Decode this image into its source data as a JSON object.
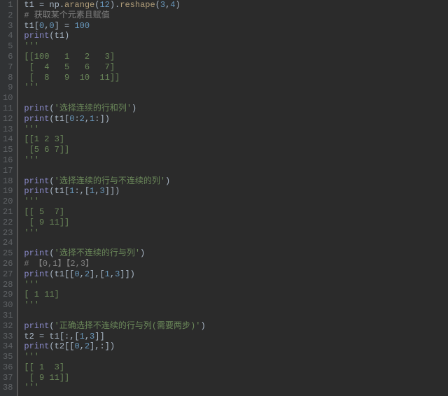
{
  "lines": [
    {
      "n": 1,
      "tokens": [
        {
          "t": "t1 ",
          "c": "tok-id"
        },
        {
          "t": "= ",
          "c": "tok-op"
        },
        {
          "t": "np",
          "c": "tok-id"
        },
        {
          "t": ".",
          "c": "tok-op"
        },
        {
          "t": "arange",
          "c": "tok-call"
        },
        {
          "t": "(",
          "c": "tok-op"
        },
        {
          "t": "12",
          "c": "tok-num"
        },
        {
          "t": ").",
          "c": "tok-op"
        },
        {
          "t": "reshape",
          "c": "tok-call"
        },
        {
          "t": "(",
          "c": "tok-op"
        },
        {
          "t": "3",
          "c": "tok-num"
        },
        {
          "t": ",",
          "c": "tok-op"
        },
        {
          "t": "4",
          "c": "tok-num"
        },
        {
          "t": ")",
          "c": "tok-op"
        }
      ]
    },
    {
      "n": 2,
      "tokens": [
        {
          "t": "# 获取某个元素且赋值",
          "c": "tok-comment"
        }
      ]
    },
    {
      "n": 3,
      "tokens": [
        {
          "t": "t1",
          "c": "tok-id"
        },
        {
          "t": "[",
          "c": "tok-op"
        },
        {
          "t": "0",
          "c": "tok-num"
        },
        {
          "t": ",",
          "c": "tok-op"
        },
        {
          "t": "0",
          "c": "tok-num"
        },
        {
          "t": "] ",
          "c": "tok-op"
        },
        {
          "t": "= ",
          "c": "tok-op"
        },
        {
          "t": "100",
          "c": "tok-num"
        }
      ]
    },
    {
      "n": 4,
      "tokens": [
        {
          "t": "print",
          "c": "tok-builtin"
        },
        {
          "t": "(",
          "c": "tok-op"
        },
        {
          "t": "t1",
          "c": "tok-id"
        },
        {
          "t": ")",
          "c": "tok-op"
        }
      ]
    },
    {
      "n": 5,
      "tokens": [
        {
          "t": "'''",
          "c": "tok-str"
        }
      ]
    },
    {
      "n": 6,
      "tokens": [
        {
          "t": "[[100   1   2   3]",
          "c": "tok-str"
        }
      ]
    },
    {
      "n": 7,
      "tokens": [
        {
          "t": " [  4   5   6   7]",
          "c": "tok-str"
        }
      ]
    },
    {
      "n": 8,
      "tokens": [
        {
          "t": " [  8   9  10  11]]",
          "c": "tok-str"
        }
      ]
    },
    {
      "n": 9,
      "tokens": [
        {
          "t": "'''",
          "c": "tok-str"
        }
      ]
    },
    {
      "n": 10,
      "tokens": []
    },
    {
      "n": 11,
      "tokens": [
        {
          "t": "print",
          "c": "tok-builtin"
        },
        {
          "t": "(",
          "c": "tok-op"
        },
        {
          "t": "'选择连续的行和列'",
          "c": "tok-str"
        },
        {
          "t": ")",
          "c": "tok-op"
        }
      ]
    },
    {
      "n": 12,
      "tokens": [
        {
          "t": "print",
          "c": "tok-builtin"
        },
        {
          "t": "(",
          "c": "tok-op"
        },
        {
          "t": "t1",
          "c": "tok-id"
        },
        {
          "t": "[",
          "c": "tok-op"
        },
        {
          "t": "0",
          "c": "tok-num"
        },
        {
          "t": ":",
          "c": "tok-op"
        },
        {
          "t": "2",
          "c": "tok-num"
        },
        {
          "t": ",",
          "c": "tok-op"
        },
        {
          "t": "1",
          "c": "tok-num"
        },
        {
          "t": ":])",
          "c": "tok-op"
        }
      ]
    },
    {
      "n": 13,
      "tokens": [
        {
          "t": "'''",
          "c": "tok-str"
        }
      ]
    },
    {
      "n": 14,
      "tokens": [
        {
          "t": "[[1 2 3]",
          "c": "tok-str"
        }
      ]
    },
    {
      "n": 15,
      "tokens": [
        {
          "t": " [5 6 7]]",
          "c": "tok-str"
        }
      ]
    },
    {
      "n": 16,
      "tokens": [
        {
          "t": "'''",
          "c": "tok-str"
        }
      ]
    },
    {
      "n": 17,
      "tokens": []
    },
    {
      "n": 18,
      "tokens": [
        {
          "t": "print",
          "c": "tok-builtin"
        },
        {
          "t": "(",
          "c": "tok-op"
        },
        {
          "t": "'选择连续的行与不连续的列'",
          "c": "tok-str"
        },
        {
          "t": ")",
          "c": "tok-op"
        }
      ]
    },
    {
      "n": 19,
      "tokens": [
        {
          "t": "print",
          "c": "tok-builtin"
        },
        {
          "t": "(",
          "c": "tok-op"
        },
        {
          "t": "t1",
          "c": "tok-id"
        },
        {
          "t": "[",
          "c": "tok-op"
        },
        {
          "t": "1",
          "c": "tok-num"
        },
        {
          "t": ":,[",
          "c": "tok-op"
        },
        {
          "t": "1",
          "c": "tok-num"
        },
        {
          "t": ",",
          "c": "tok-op"
        },
        {
          "t": "3",
          "c": "tok-num"
        },
        {
          "t": "]])",
          "c": "tok-op"
        }
      ]
    },
    {
      "n": 20,
      "tokens": [
        {
          "t": "'''",
          "c": "tok-str"
        }
      ]
    },
    {
      "n": 21,
      "tokens": [
        {
          "t": "[[ 5  7]",
          "c": "tok-str"
        }
      ]
    },
    {
      "n": 22,
      "tokens": [
        {
          "t": " [ 9 11]]",
          "c": "tok-str"
        }
      ]
    },
    {
      "n": 23,
      "tokens": [
        {
          "t": "'''",
          "c": "tok-str"
        }
      ]
    },
    {
      "n": 24,
      "tokens": []
    },
    {
      "n": 25,
      "tokens": [
        {
          "t": "print",
          "c": "tok-builtin"
        },
        {
          "t": "(",
          "c": "tok-op"
        },
        {
          "t": "'选择不连续的行与列'",
          "c": "tok-str"
        },
        {
          "t": ")",
          "c": "tok-op"
        }
      ]
    },
    {
      "n": 26,
      "tokens": [
        {
          "t": "# 【0,1】【2,3】",
          "c": "tok-comment"
        }
      ]
    },
    {
      "n": 27,
      "tokens": [
        {
          "t": "print",
          "c": "tok-builtin"
        },
        {
          "t": "(",
          "c": "tok-op"
        },
        {
          "t": "t1",
          "c": "tok-id"
        },
        {
          "t": "[[",
          "c": "tok-op"
        },
        {
          "t": "0",
          "c": "tok-num"
        },
        {
          "t": ",",
          "c": "tok-op"
        },
        {
          "t": "2",
          "c": "tok-num"
        },
        {
          "t": "],[",
          "c": "tok-op"
        },
        {
          "t": "1",
          "c": "tok-num"
        },
        {
          "t": ",",
          "c": "tok-op"
        },
        {
          "t": "3",
          "c": "tok-num"
        },
        {
          "t": "]])",
          "c": "tok-op"
        }
      ]
    },
    {
      "n": 28,
      "tokens": [
        {
          "t": "'''",
          "c": "tok-str"
        }
      ]
    },
    {
      "n": 29,
      "tokens": [
        {
          "t": "[ 1 11]",
          "c": "tok-str"
        }
      ]
    },
    {
      "n": 30,
      "tokens": [
        {
          "t": "'''",
          "c": "tok-str"
        }
      ]
    },
    {
      "n": 31,
      "tokens": []
    },
    {
      "n": 32,
      "tokens": [
        {
          "t": "print",
          "c": "tok-builtin"
        },
        {
          "t": "(",
          "c": "tok-op"
        },
        {
          "t": "'正确选择不连续的行与列(需要两步)'",
          "c": "tok-str"
        },
        {
          "t": ")",
          "c": "tok-op"
        }
      ]
    },
    {
      "n": 33,
      "tokens": [
        {
          "t": "t2 ",
          "c": "tok-id"
        },
        {
          "t": "= ",
          "c": "tok-op"
        },
        {
          "t": "t1",
          "c": "tok-id"
        },
        {
          "t": "[:,[",
          "c": "tok-op"
        },
        {
          "t": "1",
          "c": "tok-num"
        },
        {
          "t": ",",
          "c": "tok-op"
        },
        {
          "t": "3",
          "c": "tok-num"
        },
        {
          "t": "]]",
          "c": "tok-op"
        }
      ]
    },
    {
      "n": 34,
      "tokens": [
        {
          "t": "print",
          "c": "tok-builtin"
        },
        {
          "t": "(",
          "c": "tok-op"
        },
        {
          "t": "t2",
          "c": "tok-id"
        },
        {
          "t": "[[",
          "c": "tok-op"
        },
        {
          "t": "0",
          "c": "tok-num"
        },
        {
          "t": ",",
          "c": "tok-op"
        },
        {
          "t": "2",
          "c": "tok-num"
        },
        {
          "t": "],:])",
          "c": "tok-op"
        }
      ]
    },
    {
      "n": 35,
      "tokens": [
        {
          "t": "'''",
          "c": "tok-str"
        }
      ]
    },
    {
      "n": 36,
      "tokens": [
        {
          "t": "[[ 1  3]",
          "c": "tok-str"
        }
      ]
    },
    {
      "n": 37,
      "tokens": [
        {
          "t": " [ 9 11]]",
          "c": "tok-str"
        }
      ]
    },
    {
      "n": 38,
      "tokens": [
        {
          "t": "'''",
          "c": "tok-str"
        }
      ]
    }
  ]
}
